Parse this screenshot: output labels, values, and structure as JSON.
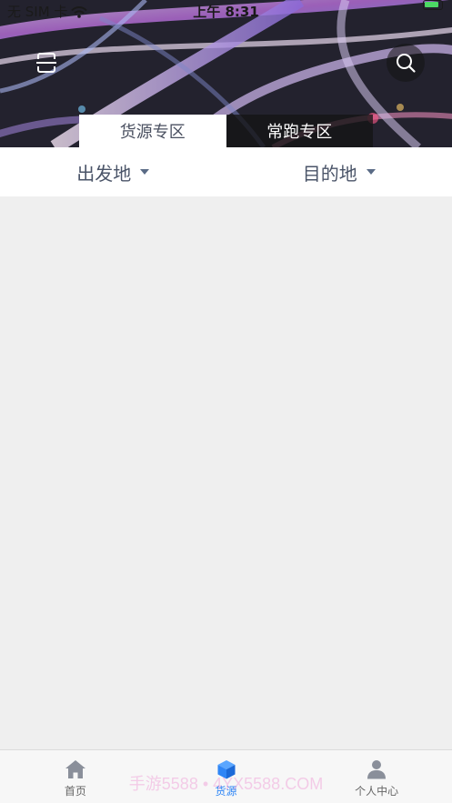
{
  "status_bar": {
    "carrier": "无 SIM 卡",
    "time": "上午 8:31"
  },
  "header": {
    "scan_icon": "scan-icon",
    "search_icon": "search-icon"
  },
  "tabs": [
    {
      "label": "货源专区",
      "active": true
    },
    {
      "label": "常跑专区",
      "active": false
    }
  ],
  "filters": {
    "origin_label": "出发地",
    "destination_label": "目的地"
  },
  "tabbar": {
    "items": [
      {
        "label": "首页",
        "icon": "home-icon",
        "active": false
      },
      {
        "label": "货源",
        "icon": "cube-icon",
        "active": true
      },
      {
        "label": "个人中心",
        "icon": "user-icon",
        "active": false
      }
    ]
  },
  "watermark": "手游5588 • 4YX5588.COM",
  "colors": {
    "accent": "#2f86f6",
    "tab_inactive_bg": "#1f1f1f",
    "page_bg": "#efefef"
  }
}
